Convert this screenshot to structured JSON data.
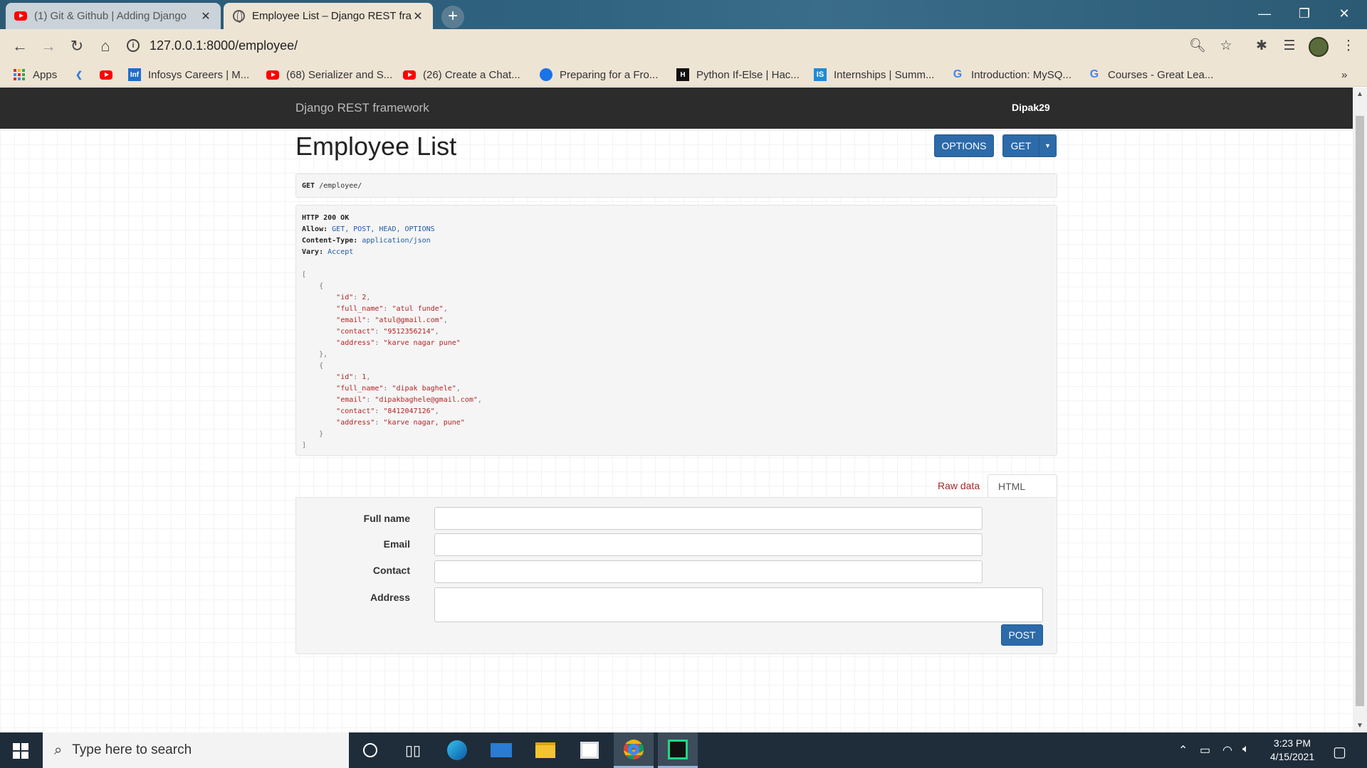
{
  "browser": {
    "tabs": [
      {
        "title": "(1) Git & Github | Adding Django",
        "icon": "youtube-icon",
        "active": false
      },
      {
        "title": "Employee List – Django REST framework",
        "icon": "globe-icon",
        "active": true
      }
    ],
    "url": "127.0.0.1:8000/employee/",
    "bookmarks": [
      {
        "label": "Apps",
        "icon": "apps-icon"
      },
      {
        "label": "",
        "icon": "kotlin-icon"
      },
      {
        "label": "",
        "icon": "youtube-icon"
      },
      {
        "label": "Infosys Careers | M...",
        "icon": "infosys-icon"
      },
      {
        "label": "(68) Serializer and S...",
        "icon": "youtube-icon"
      },
      {
        "label": "(26) Create a Chat...",
        "icon": "youtube-icon"
      },
      {
        "label": "Preparing for a Fro...",
        "icon": "globe-icon"
      },
      {
        "label": "Python If-Else | Hac...",
        "icon": "hackerrank-icon"
      },
      {
        "label": "Internships | Summ...",
        "icon": "internshala-icon"
      },
      {
        "label": "Introduction: MySQ...",
        "icon": "google-icon"
      },
      {
        "label": "Courses - Great Lea...",
        "icon": "google-icon"
      }
    ],
    "overflow": "»"
  },
  "app": {
    "brand": "Django REST framework",
    "user": "Dipak29",
    "page_title": "Employee List",
    "options_label": "OPTIONS",
    "get_label": "GET",
    "request": {
      "method": "GET",
      "path": "/employee/"
    },
    "response": {
      "status": "HTTP 200 OK",
      "headers": [
        {
          "name": "Allow:",
          "value": "GET, POST, HEAD, OPTIONS"
        },
        {
          "name": "Content-Type:",
          "value": "application/json"
        },
        {
          "name": "Vary:",
          "value": "Accept"
        }
      ],
      "body": [
        {
          "id": "2",
          "full_name": "\"atul funde\"",
          "email": "\"atul@gmail.com\"",
          "contact": "\"9512356214\"",
          "address": "\"karve nagar pune\""
        },
        {
          "id": "1",
          "full_name": "\"dipak baghele\"",
          "email": "\"dipakbaghele@gmail.com\"",
          "contact": "\"8412047126\"",
          "address": "\"karve nagar, pune\""
        }
      ]
    },
    "form_tabs": {
      "raw": "Raw data",
      "html": "HTML form"
    },
    "form": {
      "full_name_label": "Full name",
      "email_label": "Email",
      "contact_label": "Contact",
      "address_label": "Address",
      "post_label": "POST"
    }
  },
  "taskbar": {
    "search_placeholder": "Type here to search",
    "time": "3:23 PM",
    "date": "4/15/2021"
  },
  "colors": {
    "drf_nav": "#2c2c2c",
    "button_blue": "#2c6aa9",
    "raw_tab": "#a52a2a",
    "taskbar": "#1f2d3a"
  }
}
